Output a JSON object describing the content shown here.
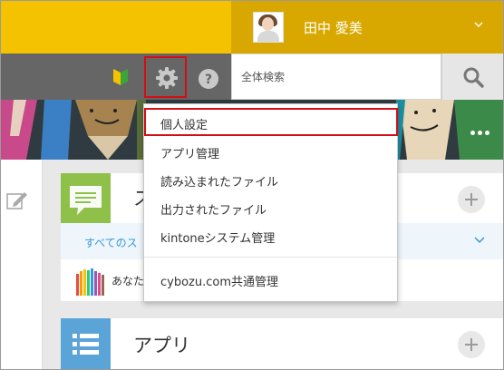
{
  "header": {
    "user_name": "田中 愛美"
  },
  "navbar": {
    "search_placeholder": "全体検索"
  },
  "settings_menu": {
    "items": [
      {
        "label": "個人設定",
        "selected": true
      },
      {
        "label": "アプリ管理"
      },
      {
        "label": "読み込まれたファイル"
      },
      {
        "label": "出力されたファイル"
      },
      {
        "label": "kintoneシステム管理"
      },
      {
        "label": "cybozu.com共通管理"
      }
    ]
  },
  "space_card": {
    "title": "ス",
    "filter_label": "すべてのス",
    "row_text": "あなた"
  },
  "app_card": {
    "title": "アプリ"
  },
  "colors": {
    "header_yellow": "#f5c200",
    "user_area": "#d9a800",
    "navbar_gray": "#666666",
    "highlight_red": "#d20f15",
    "space_green": "#8fc04a",
    "app_blue": "#5aa4d8",
    "link_blue": "#3498db"
  }
}
